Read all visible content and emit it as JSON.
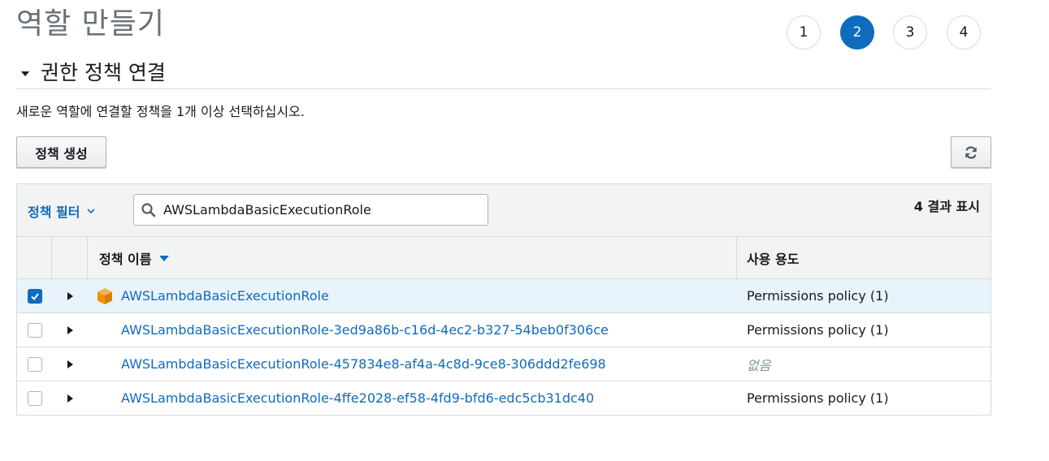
{
  "page_title": "역할 만들기",
  "steps": [
    {
      "label": "1",
      "active": false
    },
    {
      "label": "2",
      "active": true
    },
    {
      "label": "3",
      "active": false
    },
    {
      "label": "4",
      "active": false
    }
  ],
  "section": {
    "title": "권한 정책 연결",
    "description": "새로운 역할에 연결할 정책을 1개 이상 선택하십시오."
  },
  "toolbar": {
    "create_policy_label": "정책 생성",
    "refresh_icon": "refresh-icon"
  },
  "filter": {
    "dropdown_label": "정책 필터",
    "search_value": "AWSLambdaBasicExecutionRole",
    "result_count": "4 결과 표시"
  },
  "table": {
    "columns": {
      "policy_name": "정책 이름",
      "used_as": "사용 용도"
    },
    "rows": [
      {
        "name": "AWSLambdaBasicExecutionRole",
        "used_as": "Permissions policy (1)",
        "checked": true,
        "aws_managed": true
      },
      {
        "name": "AWSLambdaBasicExecutionRole-3ed9a86b-c16d-4ec2-b327-54beb0f306ce",
        "used_as": "Permissions policy (1)",
        "checked": false,
        "aws_managed": false
      },
      {
        "name": "AWSLambdaBasicExecutionRole-457834e8-af4a-4c8d-9ce8-306ddd2fe698",
        "used_as": "없음",
        "checked": false,
        "aws_managed": false
      },
      {
        "name": "AWSLambdaBasicExecutionRole-4ffe2028-ef58-4fd9-bfd6-edc5cb31dc40",
        "used_as": "Permissions policy (1)",
        "checked": false,
        "aws_managed": false
      }
    ]
  },
  "colors": {
    "accent": "#0f6bbd",
    "aws_orange": "#f29100",
    "selected_row": "#e9f3fb"
  }
}
